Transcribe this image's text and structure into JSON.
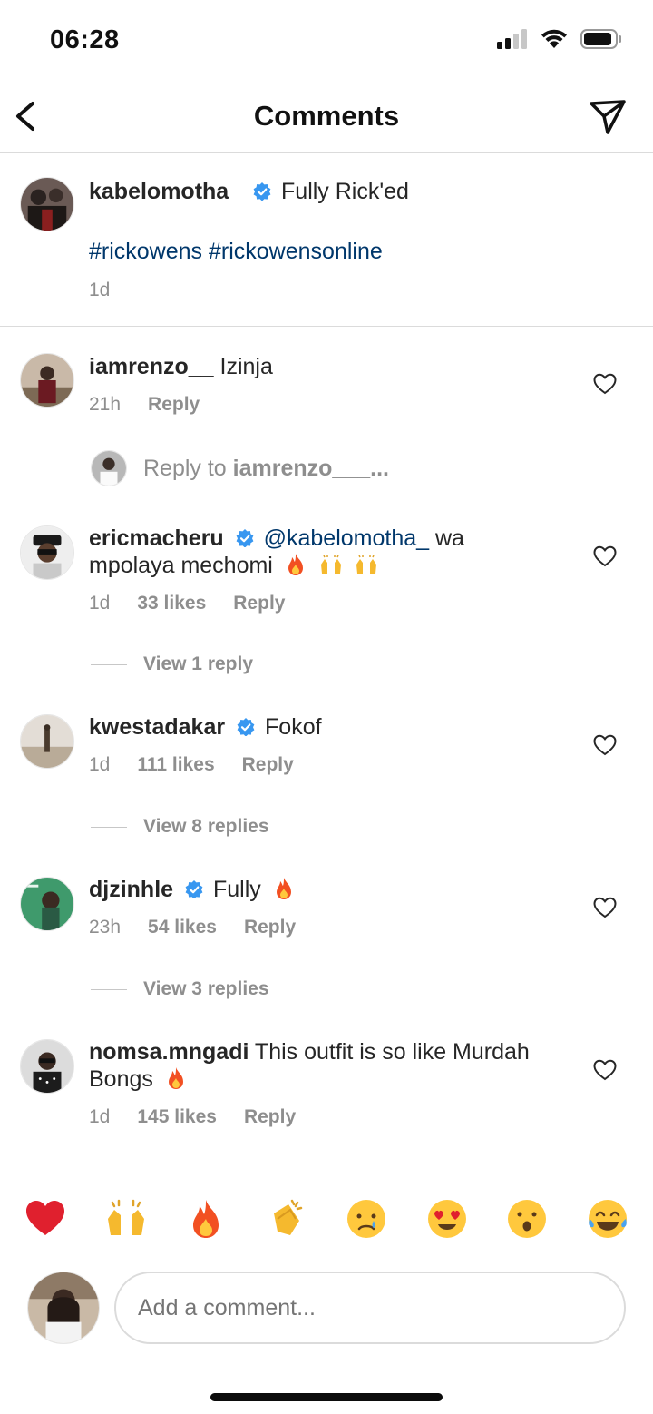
{
  "status": {
    "time": "06:28"
  },
  "nav": {
    "title": "Comments"
  },
  "caption": {
    "username": "kabelomotha_",
    "text": "Fully Rick'ed",
    "hashtags": "#rickowens #rickowensonline",
    "time": "1d"
  },
  "comments": [
    {
      "username": "iamrenzo__",
      "text": "Izinja",
      "time": "21h",
      "likes": "",
      "reply_label": "Reply"
    },
    {
      "username": "ericmacheru",
      "mention": "@kabelomotha_",
      "text1": "wa",
      "text2": "mpolaya mechomi",
      "time": "1d",
      "likes": "33 likes",
      "reply_label": "Reply",
      "view_replies": "View 1 reply"
    },
    {
      "username": "kwestadakar",
      "text": "Fokof",
      "time": "1d",
      "likes": "111 likes",
      "reply_label": "Reply",
      "view_replies": "View 8 replies"
    },
    {
      "username": "djzinhle",
      "text": "Fully",
      "time": "23h",
      "likes": "54 likes",
      "reply_label": "Reply",
      "view_replies": "View 3 replies"
    },
    {
      "username": "nomsa.mngadi",
      "text1": "This outfit is so like Murdah",
      "text2": "Bongs",
      "time": "1d",
      "likes": "145 likes",
      "reply_label": "Reply"
    }
  ],
  "reply_to": {
    "prefix": "Reply to",
    "username": "iamrenzo__...",
    "display": "iamrenzo___..."
  },
  "emoji_bar": [
    "heart",
    "raised-hands",
    "fire",
    "clapping-hands",
    "crying-face",
    "heart-eyes",
    "astonished-face",
    "tears-of-joy"
  ],
  "input": {
    "placeholder": "Add a comment..."
  },
  "colors": {
    "link": "#00376b",
    "verified": "#3897f0",
    "meta": "#8e8e8e"
  }
}
